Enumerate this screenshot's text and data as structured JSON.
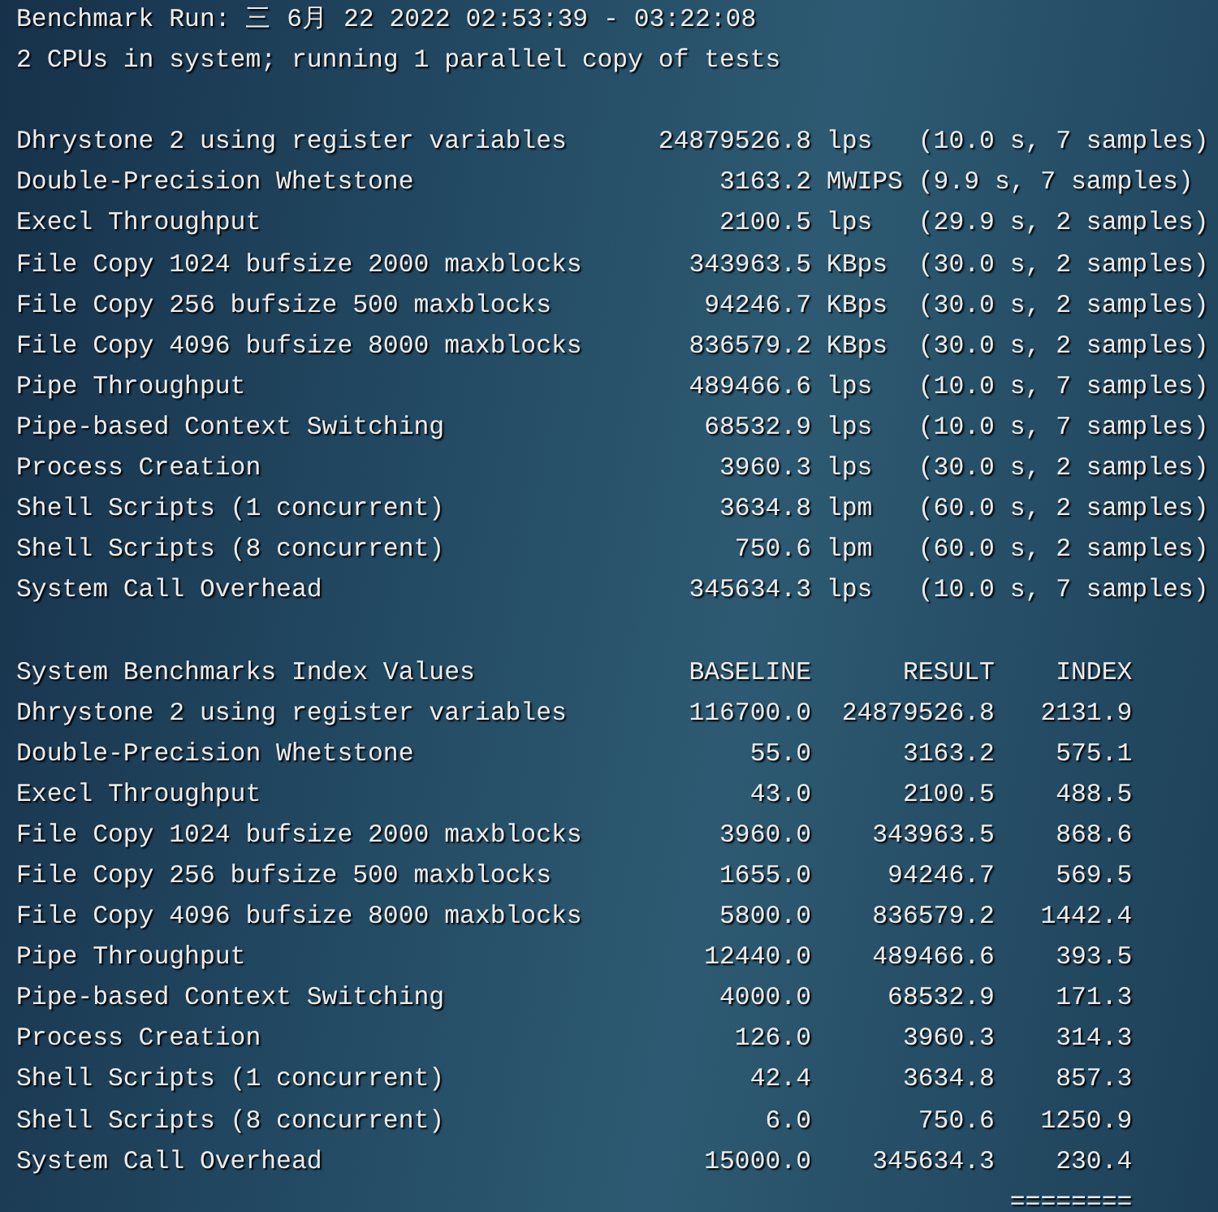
{
  "header": [
    "Benchmark Run: 三 6月 22 2022 02:53:39 - 03:22:08",
    "2 CPUs in system; running 1 parallel copy of tests"
  ],
  "results": [
    {
      "name": "Dhrystone 2 using register variables",
      "value": "24879526.8",
      "unit": "lps",
      "detail": "(10.0 s, 7 samples)"
    },
    {
      "name": "Double-Precision Whetstone",
      "value": "3163.2",
      "unit": "MWIPS",
      "detail": "(9.9 s, 7 samples)"
    },
    {
      "name": "Execl Throughput",
      "value": "2100.5",
      "unit": "lps",
      "detail": "(29.9 s, 2 samples)"
    },
    {
      "name": "File Copy 1024 bufsize 2000 maxblocks",
      "value": "343963.5",
      "unit": "KBps",
      "detail": "(30.0 s, 2 samples)"
    },
    {
      "name": "File Copy 256 bufsize 500 maxblocks",
      "value": "94246.7",
      "unit": "KBps",
      "detail": "(30.0 s, 2 samples)"
    },
    {
      "name": "File Copy 4096 bufsize 8000 maxblocks",
      "value": "836579.2",
      "unit": "KBps",
      "detail": "(30.0 s, 2 samples)"
    },
    {
      "name": "Pipe Throughput",
      "value": "489466.6",
      "unit": "lps",
      "detail": "(10.0 s, 7 samples)"
    },
    {
      "name": "Pipe-based Context Switching",
      "value": "68532.9",
      "unit": "lps",
      "detail": "(10.0 s, 7 samples)"
    },
    {
      "name": "Process Creation",
      "value": "3960.3",
      "unit": "lps",
      "detail": "(30.0 s, 2 samples)"
    },
    {
      "name": "Shell Scripts (1 concurrent)",
      "value": "3634.8",
      "unit": "lpm",
      "detail": "(60.0 s, 2 samples)"
    },
    {
      "name": "Shell Scripts (8 concurrent)",
      "value": "750.6",
      "unit": "lpm",
      "detail": "(60.0 s, 2 samples)"
    },
    {
      "name": "System Call Overhead",
      "value": "345634.3",
      "unit": "lps",
      "detail": "(10.0 s, 7 samples)"
    }
  ],
  "index": {
    "columns": [
      "System Benchmarks Index Values",
      "BASELINE",
      "RESULT",
      "INDEX"
    ],
    "rows": [
      [
        "Dhrystone 2 using register variables",
        "116700.0",
        "24879526.8",
        "2131.9"
      ],
      [
        "Double-Precision Whetstone",
        "55.0",
        "3163.2",
        "575.1"
      ],
      [
        "Execl Throughput",
        "43.0",
        "2100.5",
        "488.5"
      ],
      [
        "File Copy 1024 bufsize 2000 maxblocks",
        "3960.0",
        "343963.5",
        "868.6"
      ],
      [
        "File Copy 256 bufsize 500 maxblocks",
        "1655.0",
        "94246.7",
        "569.5"
      ],
      [
        "File Copy 4096 bufsize 8000 maxblocks",
        "5800.0",
        "836579.2",
        "1442.4"
      ],
      [
        "Pipe Throughput",
        "12440.0",
        "489466.6",
        "393.5"
      ],
      [
        "Pipe-based Context Switching",
        "4000.0",
        "68532.9",
        "171.3"
      ],
      [
        "Process Creation",
        "126.0",
        "3960.3",
        "314.3"
      ],
      [
        "Shell Scripts (1 concurrent)",
        "42.4",
        "3634.8",
        "857.3"
      ],
      [
        "Shell Scripts (8 concurrent)",
        "6.0",
        "750.6",
        "1250.9"
      ],
      [
        "System Call Overhead",
        "15000.0",
        "345634.3",
        "230.4"
      ]
    ],
    "rule": "========"
  }
}
